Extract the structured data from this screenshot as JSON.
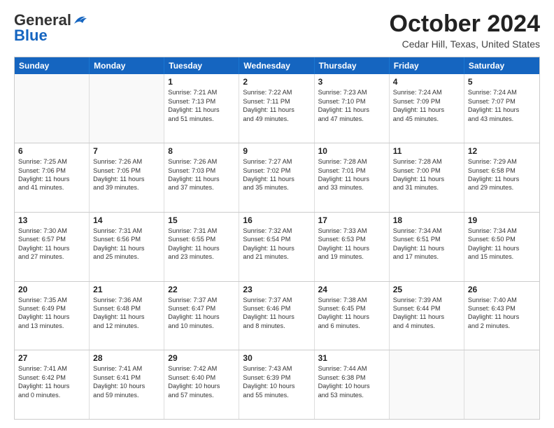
{
  "logo": {
    "line1": "General",
    "line2": "Blue"
  },
  "header": {
    "title": "October 2024",
    "location": "Cedar Hill, Texas, United States"
  },
  "weekdays": [
    "Sunday",
    "Monday",
    "Tuesday",
    "Wednesday",
    "Thursday",
    "Friday",
    "Saturday"
  ],
  "rows": [
    [
      {
        "day": "",
        "lines": [],
        "empty": true
      },
      {
        "day": "",
        "lines": [],
        "empty": true
      },
      {
        "day": "1",
        "lines": [
          "Sunrise: 7:21 AM",
          "Sunset: 7:13 PM",
          "Daylight: 11 hours",
          "and 51 minutes."
        ]
      },
      {
        "day": "2",
        "lines": [
          "Sunrise: 7:22 AM",
          "Sunset: 7:11 PM",
          "Daylight: 11 hours",
          "and 49 minutes."
        ]
      },
      {
        "day": "3",
        "lines": [
          "Sunrise: 7:23 AM",
          "Sunset: 7:10 PM",
          "Daylight: 11 hours",
          "and 47 minutes."
        ]
      },
      {
        "day": "4",
        "lines": [
          "Sunrise: 7:24 AM",
          "Sunset: 7:09 PM",
          "Daylight: 11 hours",
          "and 45 minutes."
        ]
      },
      {
        "day": "5",
        "lines": [
          "Sunrise: 7:24 AM",
          "Sunset: 7:07 PM",
          "Daylight: 11 hours",
          "and 43 minutes."
        ]
      }
    ],
    [
      {
        "day": "6",
        "lines": [
          "Sunrise: 7:25 AM",
          "Sunset: 7:06 PM",
          "Daylight: 11 hours",
          "and 41 minutes."
        ]
      },
      {
        "day": "7",
        "lines": [
          "Sunrise: 7:26 AM",
          "Sunset: 7:05 PM",
          "Daylight: 11 hours",
          "and 39 minutes."
        ]
      },
      {
        "day": "8",
        "lines": [
          "Sunrise: 7:26 AM",
          "Sunset: 7:03 PM",
          "Daylight: 11 hours",
          "and 37 minutes."
        ]
      },
      {
        "day": "9",
        "lines": [
          "Sunrise: 7:27 AM",
          "Sunset: 7:02 PM",
          "Daylight: 11 hours",
          "and 35 minutes."
        ]
      },
      {
        "day": "10",
        "lines": [
          "Sunrise: 7:28 AM",
          "Sunset: 7:01 PM",
          "Daylight: 11 hours",
          "and 33 minutes."
        ]
      },
      {
        "day": "11",
        "lines": [
          "Sunrise: 7:28 AM",
          "Sunset: 7:00 PM",
          "Daylight: 11 hours",
          "and 31 minutes."
        ]
      },
      {
        "day": "12",
        "lines": [
          "Sunrise: 7:29 AM",
          "Sunset: 6:58 PM",
          "Daylight: 11 hours",
          "and 29 minutes."
        ]
      }
    ],
    [
      {
        "day": "13",
        "lines": [
          "Sunrise: 7:30 AM",
          "Sunset: 6:57 PM",
          "Daylight: 11 hours",
          "and 27 minutes."
        ]
      },
      {
        "day": "14",
        "lines": [
          "Sunrise: 7:31 AM",
          "Sunset: 6:56 PM",
          "Daylight: 11 hours",
          "and 25 minutes."
        ]
      },
      {
        "day": "15",
        "lines": [
          "Sunrise: 7:31 AM",
          "Sunset: 6:55 PM",
          "Daylight: 11 hours",
          "and 23 minutes."
        ]
      },
      {
        "day": "16",
        "lines": [
          "Sunrise: 7:32 AM",
          "Sunset: 6:54 PM",
          "Daylight: 11 hours",
          "and 21 minutes."
        ]
      },
      {
        "day": "17",
        "lines": [
          "Sunrise: 7:33 AM",
          "Sunset: 6:53 PM",
          "Daylight: 11 hours",
          "and 19 minutes."
        ]
      },
      {
        "day": "18",
        "lines": [
          "Sunrise: 7:34 AM",
          "Sunset: 6:51 PM",
          "Daylight: 11 hours",
          "and 17 minutes."
        ]
      },
      {
        "day": "19",
        "lines": [
          "Sunrise: 7:34 AM",
          "Sunset: 6:50 PM",
          "Daylight: 11 hours",
          "and 15 minutes."
        ]
      }
    ],
    [
      {
        "day": "20",
        "lines": [
          "Sunrise: 7:35 AM",
          "Sunset: 6:49 PM",
          "Daylight: 11 hours",
          "and 13 minutes."
        ]
      },
      {
        "day": "21",
        "lines": [
          "Sunrise: 7:36 AM",
          "Sunset: 6:48 PM",
          "Daylight: 11 hours",
          "and 12 minutes."
        ]
      },
      {
        "day": "22",
        "lines": [
          "Sunrise: 7:37 AM",
          "Sunset: 6:47 PM",
          "Daylight: 11 hours",
          "and 10 minutes."
        ]
      },
      {
        "day": "23",
        "lines": [
          "Sunrise: 7:37 AM",
          "Sunset: 6:46 PM",
          "Daylight: 11 hours",
          "and 8 minutes."
        ]
      },
      {
        "day": "24",
        "lines": [
          "Sunrise: 7:38 AM",
          "Sunset: 6:45 PM",
          "Daylight: 11 hours",
          "and 6 minutes."
        ]
      },
      {
        "day": "25",
        "lines": [
          "Sunrise: 7:39 AM",
          "Sunset: 6:44 PM",
          "Daylight: 11 hours",
          "and 4 minutes."
        ]
      },
      {
        "day": "26",
        "lines": [
          "Sunrise: 7:40 AM",
          "Sunset: 6:43 PM",
          "Daylight: 11 hours",
          "and 2 minutes."
        ]
      }
    ],
    [
      {
        "day": "27",
        "lines": [
          "Sunrise: 7:41 AM",
          "Sunset: 6:42 PM",
          "Daylight: 11 hours",
          "and 0 minutes."
        ]
      },
      {
        "day": "28",
        "lines": [
          "Sunrise: 7:41 AM",
          "Sunset: 6:41 PM",
          "Daylight: 10 hours",
          "and 59 minutes."
        ]
      },
      {
        "day": "29",
        "lines": [
          "Sunrise: 7:42 AM",
          "Sunset: 6:40 PM",
          "Daylight: 10 hours",
          "and 57 minutes."
        ]
      },
      {
        "day": "30",
        "lines": [
          "Sunrise: 7:43 AM",
          "Sunset: 6:39 PM",
          "Daylight: 10 hours",
          "and 55 minutes."
        ]
      },
      {
        "day": "31",
        "lines": [
          "Sunrise: 7:44 AM",
          "Sunset: 6:38 PM",
          "Daylight: 10 hours",
          "and 53 minutes."
        ]
      },
      {
        "day": "",
        "lines": [],
        "empty": true
      },
      {
        "day": "",
        "lines": [],
        "empty": true
      }
    ]
  ]
}
